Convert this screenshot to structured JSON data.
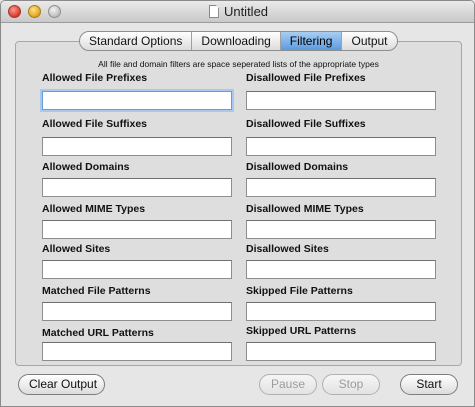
{
  "window": {
    "title": "Untitled",
    "title_icon": "document-icon"
  },
  "tabs": [
    {
      "label": "Standard Options",
      "selected": false
    },
    {
      "label": "Downloading",
      "selected": false
    },
    {
      "label": "Filtering",
      "selected": true
    },
    {
      "label": "Output",
      "selected": false
    }
  ],
  "notice": "All file and domain filters are space seperated lists of the appropriate types",
  "filters": {
    "allowed_file_prefixes": {
      "label": "Allowed File Prefixes",
      "value": ""
    },
    "disallowed_file_prefixes": {
      "label": "Disallowed File Prefixes",
      "value": ""
    },
    "allowed_file_suffixes": {
      "label": "Allowed File Suffixes",
      "value": ""
    },
    "disallowed_file_suffixes": {
      "label": "Disallowed File Suffixes",
      "value": ""
    },
    "allowed_domains": {
      "label": "Allowed Domains",
      "value": ""
    },
    "disallowed_domains": {
      "label": "Disallowed Domains",
      "value": ""
    },
    "allowed_mime_types": {
      "label": " Allowed MIME Types",
      "value": ""
    },
    "disallowed_mime_types": {
      "label": "Disallowed MIME Types",
      "value": ""
    },
    "allowed_sites": {
      "label": "Allowed Sites",
      "value": ""
    },
    "disallowed_sites": {
      "label": "Disallowed Sites",
      "value": ""
    },
    "matched_file_patterns": {
      "label": "Matched File Patterns",
      "value": ""
    },
    "skipped_file_patterns": {
      "label": "Skipped File Patterns",
      "value": ""
    },
    "matched_url_patterns": {
      "label": "Matched URL Patterns",
      "value": ""
    },
    "skipped_url_patterns": {
      "label": "Skipped URL Patterns",
      "value": ""
    }
  },
  "buttons": {
    "clear_output": {
      "label": "Clear Output",
      "enabled": true
    },
    "pause": {
      "label": "Pause",
      "enabled": false
    },
    "stop": {
      "label": "Stop",
      "enabled": false
    },
    "start": {
      "label": "Start",
      "enabled": true
    }
  }
}
